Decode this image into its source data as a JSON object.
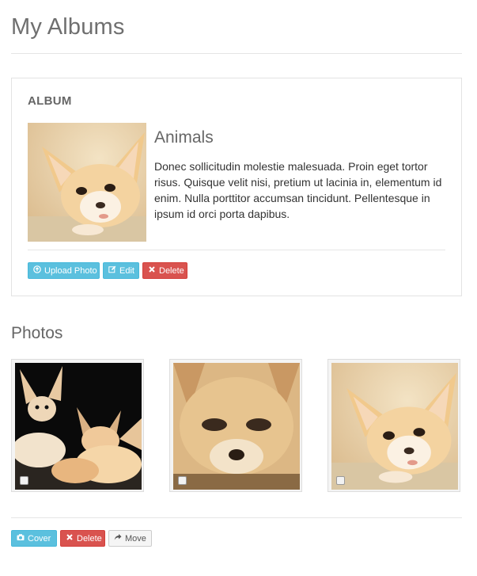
{
  "page": {
    "title": "My Albums"
  },
  "album": {
    "heading": "ALBUM",
    "name": "Animals",
    "description": "Donec sollicitudin molestie malesuada. Proin eget tortor risus. Quisque velit nisi, pretium ut lacinia in, elementum id enim. Nulla porttitor accumsan tincidunt. Pellentesque in ipsum id orci porta dapibus.",
    "cover_image": "fennec-fox-kit",
    "actions": {
      "upload_label": "Upload Photo",
      "edit_label": "Edit",
      "delete_label": "Delete"
    }
  },
  "photos": {
    "title": "Photos",
    "items": [
      {
        "image": "fennec-foxes-group",
        "selected": false
      },
      {
        "image": "fennec-fox-face",
        "selected": false
      },
      {
        "image": "fennec-fox-kit",
        "selected": false
      }
    ],
    "actions": {
      "cover_label": "Cover",
      "delete_label": "Delete",
      "move_label": "Move"
    }
  },
  "colors": {
    "info": "#5bc0de",
    "danger": "#d9534f",
    "default": "#f5f5f5",
    "heading": "#666666"
  },
  "icons": {
    "upload": "circle-arrow-up-icon",
    "edit": "pencil-square-icon",
    "delete": "x-icon",
    "cover": "camera-icon",
    "move": "share-arrow-icon"
  }
}
